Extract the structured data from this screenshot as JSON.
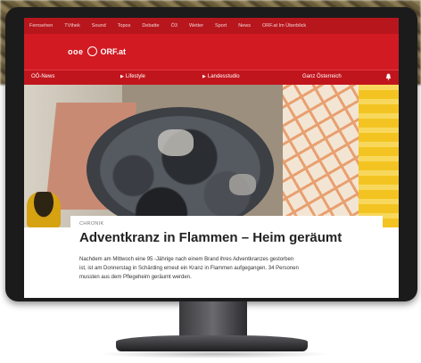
{
  "topnav": {
    "items": [
      "Fernsehen",
      "TVthek",
      "Sound",
      "Topos",
      "Debatte",
      "Ö3",
      "Wetter",
      "Sport",
      "News",
      "ORF.at Im Überblick"
    ]
  },
  "brand": {
    "station": "ooe",
    "site": "ORF.at"
  },
  "catnav": {
    "items": [
      "OÖ-News",
      "Lifestyle",
      "Landesstudio",
      "Ganz Österreich"
    ],
    "bell_icon": "bell-icon"
  },
  "article": {
    "kicker": "CHRONIK",
    "headline": "Adventkranz in Flammen – Heim geräumt",
    "teaser_lines": [
      "Nachdem am Mittwoch eine 95 -Jährige nach einem Brand ihres Adventkranzes gestorben",
      "ist, ist am Donnerstag in Schärding erneut ein Kranz in Flammen aufgegangen. 34 Personen",
      "mussten aus dem Pflegeheim geräumt werden."
    ]
  },
  "colors": {
    "brand_red": "#d21a22",
    "nav_dark_red": "#b7161d",
    "monitor_bezel": "#1b1b1c"
  }
}
